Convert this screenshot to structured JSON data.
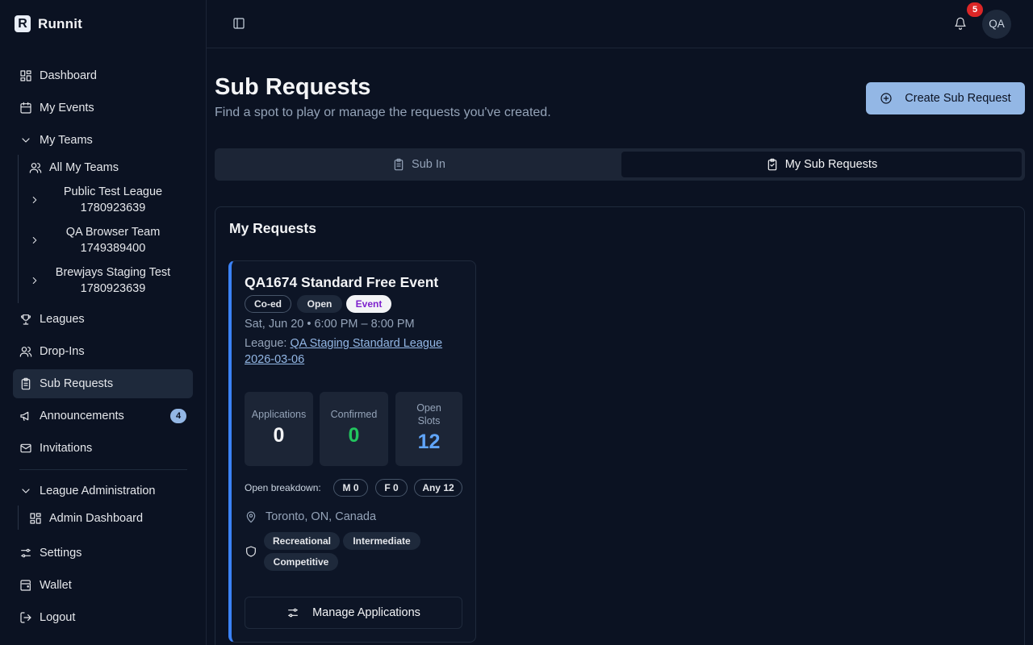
{
  "brand": {
    "logo_letter": "R",
    "name": "Runnit"
  },
  "sidebar": {
    "dashboard": "Dashboard",
    "my_events": "My Events",
    "my_teams": "My Teams",
    "all_my_teams": "All My Teams",
    "teams": [
      {
        "name": "Public Test League",
        "id": "1780923639"
      },
      {
        "name": "QA Browser Team",
        "id": "1749389400"
      },
      {
        "name": "Brewjays Staging Test",
        "id": "1780923639"
      }
    ],
    "leagues": "Leagues",
    "drop_ins": "Drop-Ins",
    "sub_requests": "Sub Requests",
    "announcements": "Announcements",
    "announcements_count": "4",
    "invitations": "Invitations",
    "league_admin": "League Administration",
    "admin_dashboard": "Admin Dashboard",
    "settings": "Settings",
    "wallet": "Wallet",
    "logout": "Logout"
  },
  "topbar": {
    "notification_count": "5",
    "avatar_initials": "QA"
  },
  "page": {
    "title": "Sub Requests",
    "subtitle": "Find a spot to play or manage the requests you've created.",
    "create_button": "Create Sub Request"
  },
  "tabs": {
    "sub_in": "Sub In",
    "my_sub_requests": "My Sub Requests",
    "active": "my_sub_requests"
  },
  "panel": {
    "title": "My Requests"
  },
  "request": {
    "title": "QA1674 Standard Free Event",
    "tags": {
      "gender": "Co-ed",
      "status": "Open",
      "type": "Event"
    },
    "datetime": "Sat, Jun 20 • 6:00 PM – 8:00 PM",
    "league_label": "League:",
    "league_name": "QA Staging Standard League 2026-03-06",
    "stats": {
      "applications_label": "Applications",
      "applications": "0",
      "confirmed_label": "Confirmed",
      "confirmed": "0",
      "open_slots_label": "Open Slots",
      "open_slots": "12"
    },
    "breakdown_label": "Open breakdown:",
    "breakdown": {
      "m": "M 0",
      "f": "F 0",
      "any": "Any 12"
    },
    "location": "Toronto, ON, Canada",
    "levels": [
      "Recreational",
      "Intermediate",
      "Competitive"
    ],
    "manage_button": "Manage Applications"
  },
  "colors": {
    "background": "#0b1222",
    "accent": "#93b7e5",
    "card_border_accent": "#3b82f6",
    "confirmed_green": "#22c55e",
    "open_slots_blue": "#60a5fa",
    "notification_red": "#dc2626",
    "event_purple": "#7e22ce"
  }
}
